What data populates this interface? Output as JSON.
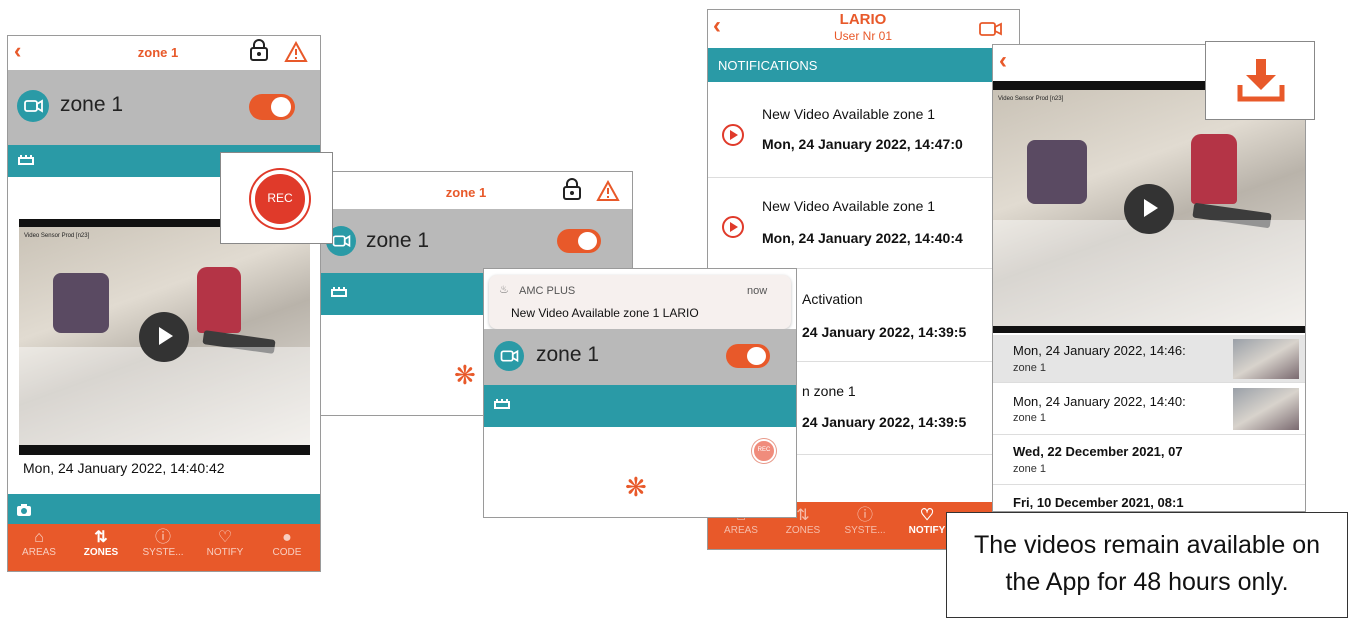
{
  "screen1": {
    "title": "zone 1",
    "back_icon": "chevron-left-icon",
    "lock_icon": "padlock-icon",
    "warning_icon": "warning-triangle-icon",
    "zone_label": "zone 1",
    "toggle_on": true,
    "video_overlay_text": "Video Sensor Prod [n23]",
    "timestamp": "Mon, 24 January 2022, 14:40:42",
    "nav": [
      {
        "label": "AREAS",
        "icon": "house-icon"
      },
      {
        "label": "ZONES",
        "icon": "zones-icon"
      },
      {
        "label": "SYSTE...",
        "icon": "info-icon"
      },
      {
        "label": "NOTIFY",
        "icon": "bell-camera-icon"
      },
      {
        "label": "CODE",
        "icon": "user-icon"
      }
    ],
    "rec_label": "REC"
  },
  "screen2": {
    "title": "zone 1",
    "zone_label": "zone 1"
  },
  "screen3": {
    "push_app": "AMC PLUS",
    "push_time": "now",
    "push_text": "New Video Available zone 1 LARIO",
    "zone_label": "zone 1",
    "rec_label": "REC"
  },
  "screen4": {
    "title": "LARIO",
    "subtitle": "User  Nr 01",
    "section": "NOTIFICATIONS",
    "notifications": [
      {
        "title": "New Video Available zone 1",
        "date": "Mon, 24 January 2022, 14:47:0"
      },
      {
        "title": "New Video Available zone 1",
        "date": "Mon, 24 January 2022, 14:40:4"
      },
      {
        "title": "Activation",
        "date": "24 January 2022, 14:39:5"
      },
      {
        "title": "n  zone 1",
        "date": "24 January 2022, 14:39:5"
      }
    ],
    "nav": [
      {
        "label": "AREAS"
      },
      {
        "label": "ZONES"
      },
      {
        "label": "SYSTE..."
      },
      {
        "label": "NOTIFY"
      }
    ]
  },
  "screen5": {
    "video_overlay_text": "Video Sensor Prod [n23]",
    "videos": [
      {
        "date": "Mon, 24 January 2022, 14:46:",
        "zone": "zone 1"
      },
      {
        "date": "Mon, 24 January 2022, 14:40:",
        "zone": "zone 1"
      },
      {
        "date": "Wed, 22 December 2021, 07",
        "zone": "zone 1"
      },
      {
        "date": "Fri, 10 December 2021, 08:1",
        "zone": ""
      }
    ]
  },
  "caption": {
    "line1": "The videos remain available on",
    "line2": "the App for 48 hours only."
  },
  "colors": {
    "accent": "#e8592a",
    "teal": "#2a9aa6",
    "gray": "#b9b9b9",
    "rec": "#e03a2a"
  }
}
